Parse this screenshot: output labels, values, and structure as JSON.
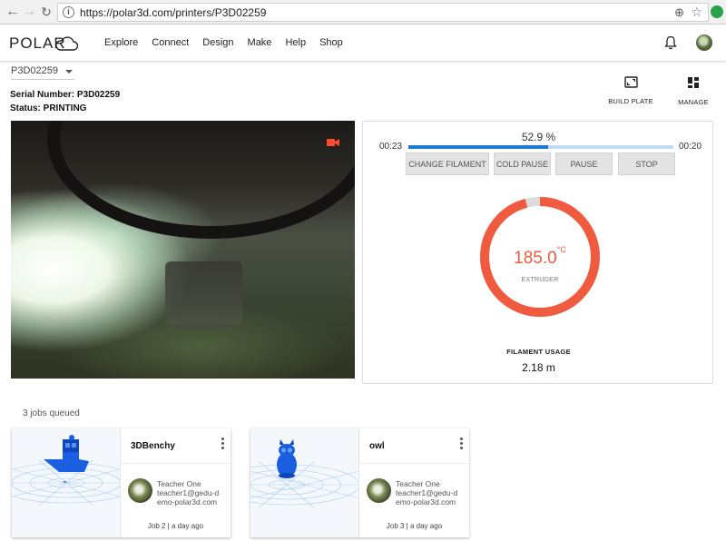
{
  "browser": {
    "url": "https://polar3d.com/printers/P3D02259"
  },
  "header": {
    "logo": "POLAR",
    "menu": [
      "Explore",
      "Connect",
      "Design",
      "Make",
      "Help",
      "Shop"
    ]
  },
  "printer": {
    "selected": "P3D02259",
    "serial_label": "Serial Number: P3D02259",
    "status_label": "Status: PRINTING"
  },
  "tools": {
    "build_plate": "BUILD PLATE",
    "manage": "MANAGE"
  },
  "progress": {
    "percent_text": "52.9 %",
    "fraction": 0.529,
    "elapsed": "00:23",
    "remaining": "00:20"
  },
  "actions": {
    "change_filament": "CHANGE FILAMENT",
    "cold_pause": "COLD PAUSE",
    "pause": "PAUSE",
    "stop": "STOP"
  },
  "extruder": {
    "value": "185.0",
    "unit": "°C",
    "label": "EXTRUDER",
    "fraction": 0.96
  },
  "filament": {
    "label": "FILAMENT USAGE",
    "value": "2.18 m"
  },
  "queue": {
    "label": "3 jobs queued",
    "jobs": [
      {
        "name": "3DBenchy",
        "owner": "Teacher One",
        "email_line1": "teacher1@gedu-d",
        "email_line2": "emo-polar3d.com",
        "meta": "Job 2 | a day ago"
      },
      {
        "name": "owl",
        "owner": "Teacher One",
        "email_line1": "teacher1@gedu-d",
        "email_line2": "emo-polar3d.com",
        "meta": "Job 3 | a day ago"
      }
    ]
  },
  "colors": {
    "accent": "#1f79d0",
    "temperature": "#f05a3f",
    "model_blue": "#1a5fe0"
  }
}
